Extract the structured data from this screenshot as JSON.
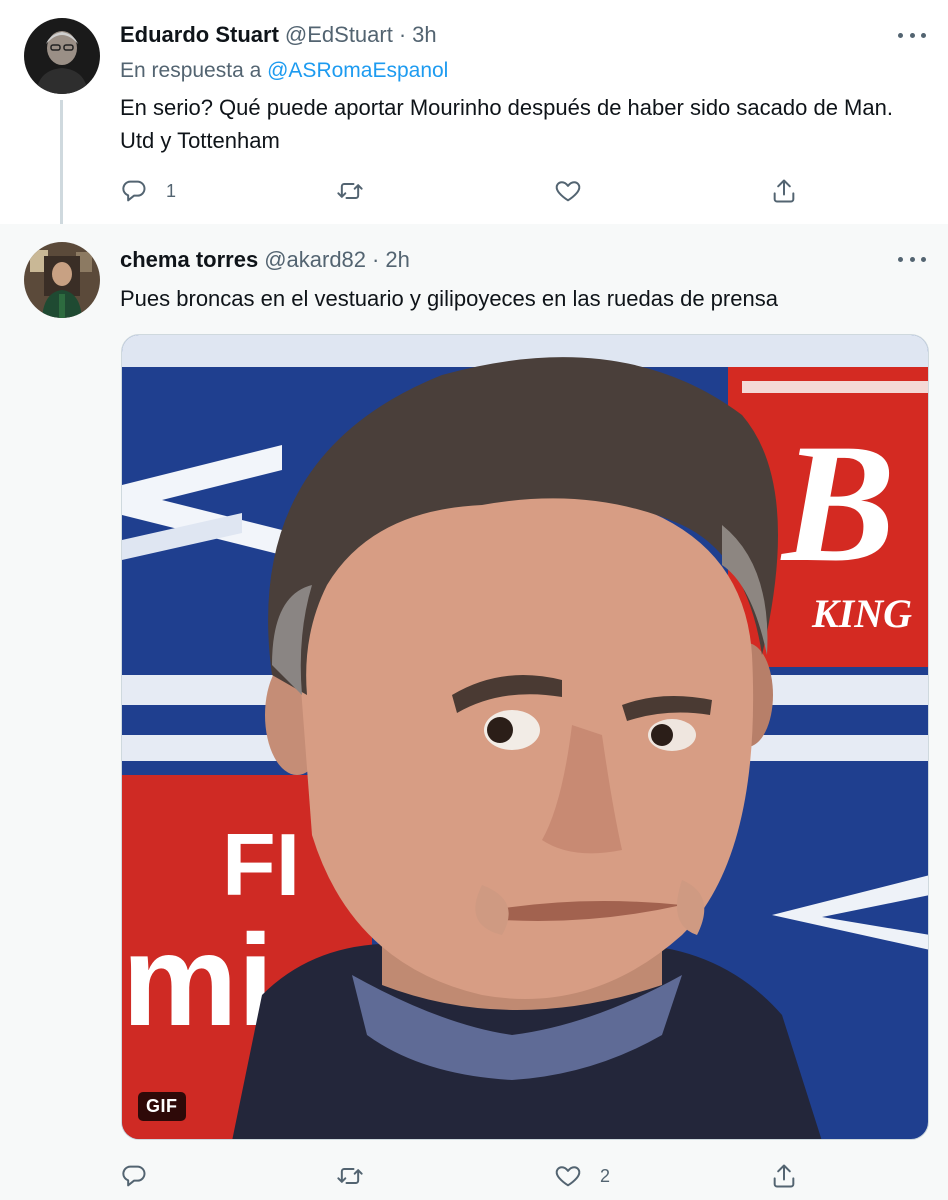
{
  "tweets": [
    {
      "display_name": "Eduardo Stuart",
      "handle": "@EdStuart",
      "separator": "·",
      "time": "3h",
      "reply_prefix": "En respuesta a",
      "reply_mention": "@ASRomaEspanol",
      "text": "En serio? Qué puede aportar Mourinho después de haber sido sacado de Man. Utd y Tottenham",
      "actions": {
        "reply_count": "1",
        "retweet_count": "",
        "like_count": "",
        "reply_icon": "reply-icon",
        "retweet_icon": "retweet-icon",
        "like_icon": "heart-icon",
        "share_icon": "share-icon"
      }
    },
    {
      "display_name": "chema torres",
      "handle": "@akard82",
      "separator": "·",
      "time": "2h",
      "text": "Pues broncas en el vestuario y gilipoyeces en las ruedas de prensa",
      "media": {
        "type": "gif",
        "badge": "GIF",
        "banner_letters_1": "B",
        "banner_letters_2": "KING",
        "banner_letters_3": "FI",
        "banner_letters_4": "mi"
      },
      "actions": {
        "reply_count": "",
        "retweet_count": "",
        "like_count": "2",
        "reply_icon": "reply-icon",
        "retweet_icon": "retweet-icon",
        "like_icon": "heart-icon",
        "share_icon": "share-icon"
      }
    }
  ],
  "colors": {
    "text_primary": "#0f1419",
    "text_secondary": "#536471",
    "accent": "#1d9bf0",
    "thread_line": "#cfd9de",
    "highlight_bg": "#f7f9f9"
  }
}
